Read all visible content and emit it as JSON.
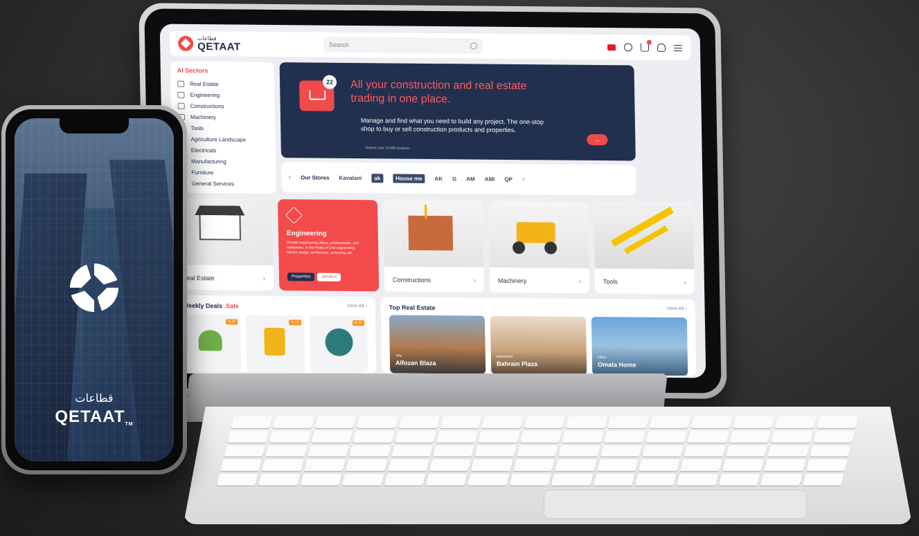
{
  "header": {
    "logo_ar": "قطاعات",
    "logo_en": "QETAAT",
    "search_placeholder": "Search"
  },
  "sidebar": {
    "title": "Al Sectors",
    "items": [
      {
        "label": "Real Estate",
        "icon": "building-icon"
      },
      {
        "label": "Engineering",
        "icon": "drafting-icon"
      },
      {
        "label": "Constructions",
        "icon": "construction-icon"
      },
      {
        "label": "Machinery",
        "icon": "truck-icon"
      },
      {
        "label": "Tools",
        "icon": "tools-icon"
      },
      {
        "label": "Agriculture Landscape",
        "icon": "leaf-icon"
      },
      {
        "label": "Electricals",
        "icon": "bulb-icon"
      },
      {
        "label": "Manufacturing",
        "icon": "factory-icon"
      },
      {
        "label": "Furniture",
        "icon": "sofa-icon"
      },
      {
        "label": "General Services",
        "icon": "services-icon"
      }
    ]
  },
  "hero": {
    "badge": "22",
    "title": "All your construction and real estate trading in one place.",
    "subtitle": "Manage and find what you need to build any project. The one-stop shop to buy or sell construction products and properties.",
    "note": "Search over 10,000 products",
    "cta_arrow": "→"
  },
  "stores": {
    "title": "Our Stores",
    "prev": "‹",
    "next": "›",
    "logos": [
      "Kavalani",
      "ak",
      "House me",
      "AK",
      "G",
      "AM",
      "AMI",
      "QP"
    ]
  },
  "tiles": [
    {
      "label": "Real Estate",
      "arrow": "›"
    },
    {
      "label": "Constructions",
      "arrow": "›"
    },
    {
      "label": "Machinery",
      "arrow": "›"
    },
    {
      "label": "Tools",
      "arrow": "›"
    }
  ],
  "engineering_tile": {
    "title": "Engineering",
    "description": "Provide engineering offices, professionals, and companies, in the Fields of Civil engineering, interior design, architecture, surveying, etc.",
    "btn_properties": "Properties",
    "btn_vendors": "Vendors"
  },
  "deals": {
    "title_main": "Weekly Deals",
    "title_accent": " .Sale",
    "view_all": "View All ›",
    "items": [
      {
        "tag": "% 40"
      },
      {
        "tag": "% 15"
      },
      {
        "tag": "% 20"
      }
    ]
  },
  "top_real_estate": {
    "title": "Top Real Estate",
    "view_all": "View All ›",
    "items": [
      {
        "type": "Villa",
        "name": "Alfozan Blaza"
      },
      {
        "type": "Apartment",
        "name": "Bahrain Plaza"
      },
      {
        "type": "Office",
        "name": "Omata Home"
      }
    ]
  },
  "phone": {
    "brand_ar": "قطاعات",
    "brand_en": "QETAAT",
    "tm": "TM"
  }
}
